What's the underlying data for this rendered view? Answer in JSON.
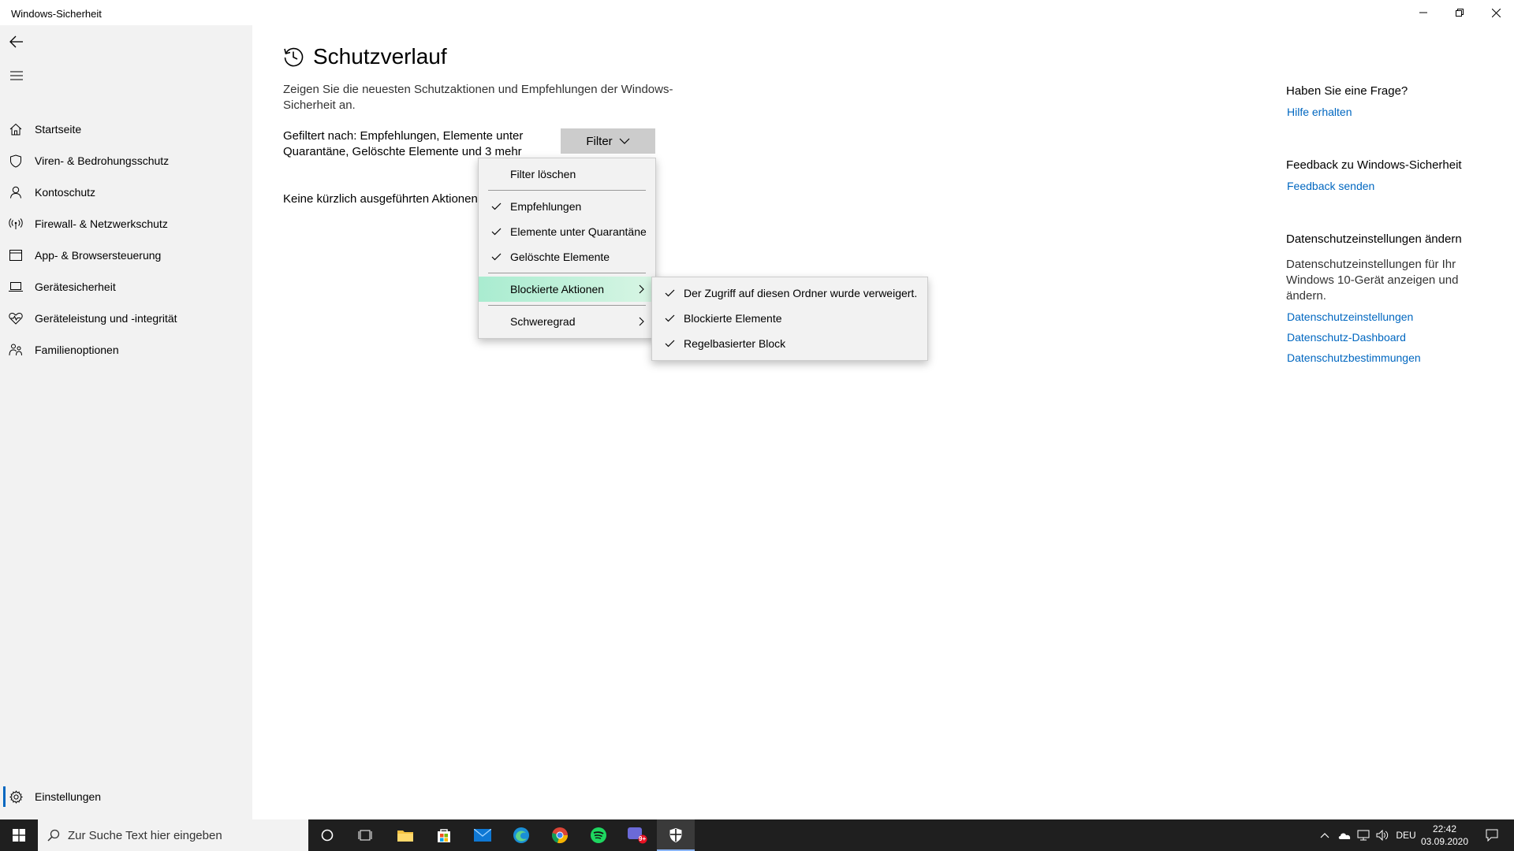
{
  "window": {
    "title": "Windows-Sicherheit"
  },
  "sidebar": {
    "items": [
      {
        "label": "Startseite",
        "icon": "home-icon"
      },
      {
        "label": "Viren- & Bedrohungsschutz",
        "icon": "shield-icon"
      },
      {
        "label": "Kontoschutz",
        "icon": "person-icon"
      },
      {
        "label": "Firewall- & Netzwerkschutz",
        "icon": "antenna-icon"
      },
      {
        "label": "App- & Browsersteuerung",
        "icon": "browser-window-icon"
      },
      {
        "label": "Gerätesicherheit",
        "icon": "laptop-icon"
      },
      {
        "label": "Geräteleistung und -integrität",
        "icon": "heart-icon"
      },
      {
        "label": "Familienoptionen",
        "icon": "family-icon"
      }
    ],
    "settings_label": "Einstellungen"
  },
  "main": {
    "title": "Schutzverlauf",
    "description": "Zeigen Sie die neuesten Schutzaktionen und Empfehlungen der Windows-Sicherheit an.",
    "filtered_by": "Gefiltert nach: Empfehlungen, Elemente unter Quarantäne, Gelöschte Elemente und 3 mehr",
    "filter_button": "Filter",
    "no_actions": "Keine kürzlich ausgeführten Aktionen"
  },
  "filter_menu": {
    "clear": "Filter löschen",
    "items": [
      {
        "label": "Empfehlungen",
        "checked": true
      },
      {
        "label": "Elemente unter Quarantäne",
        "checked": true
      },
      {
        "label": "Gelöschte Elemente",
        "checked": true
      }
    ],
    "blocked_actions": "Blockierte Aktionen",
    "severity": "Schweregrad"
  },
  "submenu": {
    "items": [
      {
        "label": "Der Zugriff auf diesen Ordner wurde verweigert.",
        "checked": true
      },
      {
        "label": "Blockierte Elemente",
        "checked": true
      },
      {
        "label": "Regelbasierter Block",
        "checked": true
      }
    ]
  },
  "right_panel": {
    "question_title": "Haben Sie eine Frage?",
    "help_link": "Hilfe erhalten",
    "feedback_title": "Feedback zu Windows-Sicherheit",
    "feedback_link": "Feedback senden",
    "privacy_title": "Datenschutzeinstellungen ändern",
    "privacy_desc": "Datenschutzeinstellungen für Ihr Windows 10-Gerät anzeigen und ändern.",
    "privacy_links": [
      "Datenschutzeinstellungen",
      "Datenschutz-Dashboard",
      "Datenschutzbestimmungen"
    ]
  },
  "taskbar": {
    "search_placeholder": "Zur Suche Text hier eingeben",
    "language": "DEU",
    "time": "22:42",
    "date": "03.09.2020",
    "badge": "9+"
  },
  "colors": {
    "accent_link": "#0067c0",
    "sidebar_bg": "#f2f2f2",
    "highlight": "#b8f0d8",
    "taskbar_bg": "#1f1f1f"
  }
}
